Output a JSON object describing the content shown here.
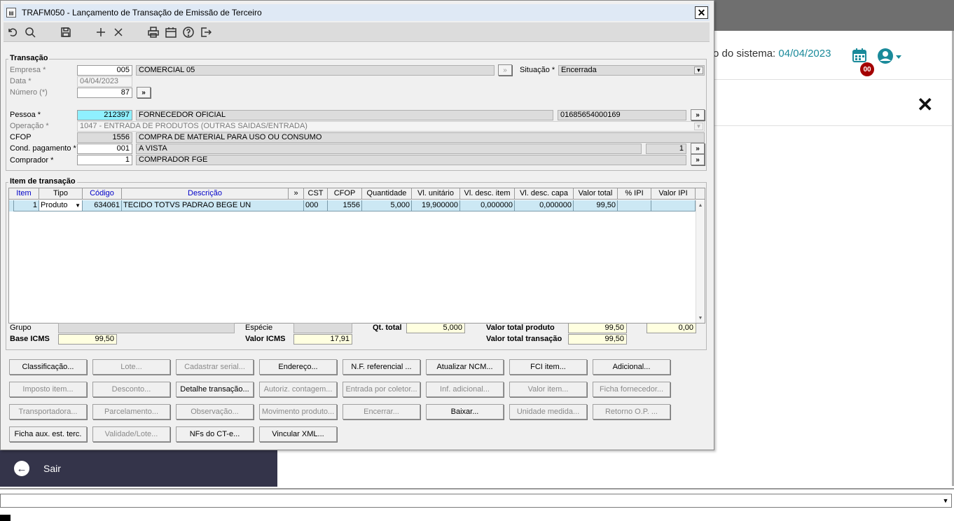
{
  "background": {
    "system_label": "o do sistema:",
    "system_date": "04/04/2023",
    "badge": "00",
    "close": "✕",
    "sair": "Sair"
  },
  "window": {
    "title": "TRAFM050 - Lançamento de Transação de Emissão de Terceiro",
    "close": "✕"
  },
  "toolbar": {
    "icons": [
      "undo-icon",
      "search-icon",
      "save-icon",
      "add-icon",
      "delete-icon",
      "print-icon",
      "calendar-icon",
      "help-icon",
      "exit-icon"
    ]
  },
  "transacao": {
    "group_label": "Transação",
    "empresa_label": "Empresa *",
    "empresa_code": "005",
    "empresa_name": "COMERCIAL 05",
    "situacao_label": "Situação *",
    "situacao_value": "Encerrada",
    "data_label": "Data *",
    "data_value": "04/04/2023",
    "numero_label": "Número (*)",
    "numero_value": "87",
    "pessoa_label": "Pessoa *",
    "pessoa_code": "212397",
    "pessoa_name": "FORNECEDOR OFICIAL",
    "pessoa_doc": "01685654000169",
    "operacao_label": "Operação *",
    "operacao_value": "1047 - ENTRADA DE PRODUTOS (OUTRAS SAIDAS/ENTRADA)",
    "cfop_label": "CFOP",
    "cfop_code": "1556",
    "cfop_desc": "COMPRA DE MATERIAL PARA USO OU CONSUMO",
    "cond_label": "Cond. pagamento *",
    "cond_code": "001",
    "cond_desc": "A VISTA",
    "cond_num": "1",
    "comprador_label": "Comprador *",
    "comprador_code": "1",
    "comprador_name": "COMPRADOR FGE",
    "more": "»"
  },
  "itens": {
    "group_label": "Item de transação",
    "columns": [
      "Item",
      "Tipo",
      "Código",
      "Descrição",
      "»",
      "CST",
      "CFOP",
      "Quantidade",
      "Vl. unitário",
      "Vl. desc. item",
      "Vl. desc. capa",
      "Valor total",
      "% IPI",
      "Valor IPI"
    ],
    "rows": [
      {
        "item": "1",
        "tipo": "Produto",
        "codigo": "634061",
        "descricao": "TECIDO TOTVS PADRAO BEGE UN",
        "cst": "000",
        "cfop": "1556",
        "quantidade": "5,000",
        "vl_unitario": "19,900000",
        "vl_desc_item": "0,000000",
        "vl_desc_capa": "0,000000",
        "valor_total": "99,50",
        "pct_ipi": "",
        "valor_ipi": ""
      }
    ]
  },
  "totais": {
    "grupo_label": "Grupo",
    "especie_label": "Espécie",
    "qt_total_label": "Qt. total",
    "qt_total": "5,000",
    "valor_total_produto_label": "Valor total produto",
    "valor_total_produto": "99,50",
    "extra_value": "0,00",
    "base_icms_label": "Base ICMS",
    "base_icms": "99,50",
    "valor_icms_label": "Valor ICMS",
    "valor_icms": "17,91",
    "valor_total_transacao_label": "Valor total transação",
    "valor_total_transacao": "99,50"
  },
  "buttons": [
    [
      "Classificação...",
      "Lote...",
      "Cadastrar serial...",
      "Endereço...",
      "N.F. referencial ...",
      "Atualizar NCM...",
      "FCI item...",
      "Adicional..."
    ],
    [
      "Imposto item...",
      "Desconto...",
      "Detalhe transação...",
      "Autoriz. contagem...",
      "Entrada por coletor...",
      "Inf. adicional...",
      "Valor item...",
      "Ficha fornecedor..."
    ],
    [
      "Transportadora...",
      "Parcelamento...",
      "Observação...",
      "Movimento produto...",
      "Encerrar...",
      "Baixar...",
      "Unidade medida...",
      "Retorno O.P. ..."
    ],
    [
      "Ficha aux. est. terc.",
      "Validade/Lote...",
      "NFs do CT-e...",
      "Vincular XML..."
    ]
  ]
}
